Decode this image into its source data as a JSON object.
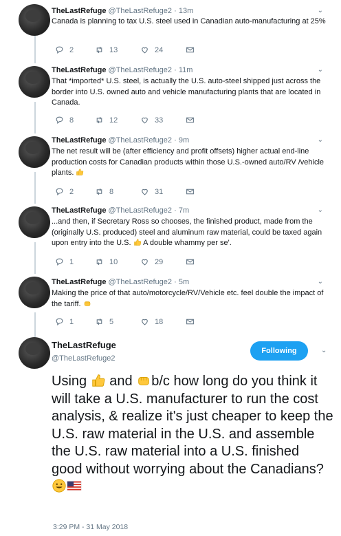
{
  "tweets": [
    {
      "name": "TheLastRefuge",
      "handle": "@TheLastRefuge2",
      "time": "13m",
      "text": "Canada is planning to tax U.S. steel used in Canadian auto-manufacturing at 25%",
      "replies": "2",
      "retweets": "13",
      "likes": "24"
    },
    {
      "name": "TheLastRefuge",
      "handle": "@TheLastRefuge2",
      "time": "11m",
      "text": "That *imported* U.S. steel, is actually the U.S. auto-steel shipped just across the border into U.S. owned auto and vehicle manufacturing plants that are located in Canada.",
      "replies": "8",
      "retweets": "12",
      "likes": "33"
    },
    {
      "name": "TheLastRefuge",
      "handle": "@TheLastRefuge2",
      "time": "9m",
      "text": "The net result will be (after efficiency and profit offsets) higher actual end-line production costs for Canadian products within those U.S.-owned auto/RV /vehicle plants.",
      "replies": "2",
      "retweets": "8",
      "likes": "31"
    },
    {
      "name": "TheLastRefuge",
      "handle": "@TheLastRefuge2",
      "time": "7m",
      "text_a": "...and then, if Secretary Ross so chooses, the finished product, made from the (originally U.S. produced) steel and aluminum raw material, could be taxed again upon entry into the U.S.",
      "text_b": "A double whammy per se'.",
      "replies": "1",
      "retweets": "10",
      "likes": "29"
    },
    {
      "name": "TheLastRefuge",
      "handle": "@TheLastRefuge2",
      "time": "5m",
      "text": "Making the price of that auto/motorcycle/RV/Vehicle etc. feel double the impact of the tariff.",
      "replies": "1",
      "retweets": "5",
      "likes": "18"
    }
  ],
  "separator": "·",
  "main": {
    "name": "TheLastRefuge",
    "handle": "@TheLastRefuge2",
    "follow_label": "Following",
    "text_a": "Using",
    "text_b": "and",
    "text_c": "b/c how long do you think it will take a U.S. manufacturer to run the cost analysis, & realize it's just cheaper to keep the U.S. raw material in the U.S. and assemble the U.S. raw material into a U.S. finished good without worrying about the Canadians?",
    "timestamp": "3:29 PM - 31 May 2018"
  },
  "icons": {
    "reply": "reply-icon",
    "retweet": "retweet-icon",
    "like": "heart-icon",
    "dm": "envelope-icon",
    "more": "chevron-down-icon"
  },
  "colors": {
    "accent": "#1da1f2",
    "muted": "#657786",
    "thread": "#ccd6dd"
  }
}
